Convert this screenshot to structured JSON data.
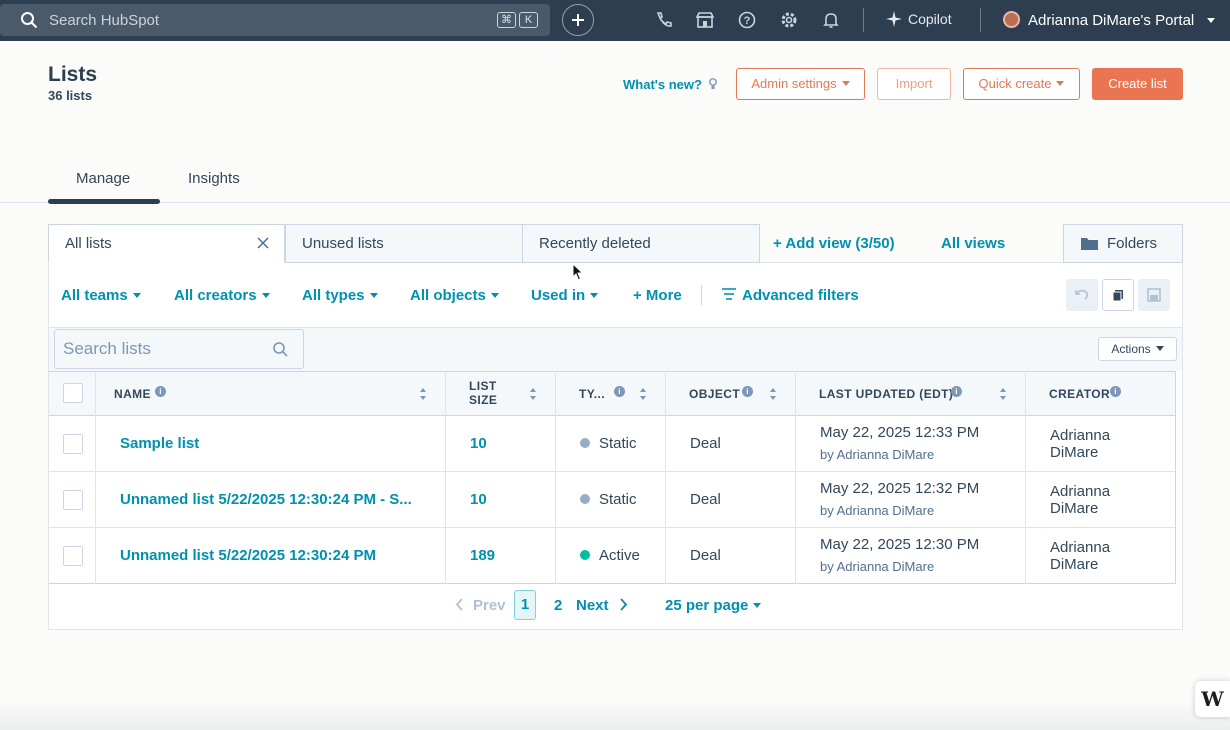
{
  "topnav": {
    "search_placeholder": "Search HubSpot",
    "shortcut_keys": [
      "⌘",
      "K"
    ],
    "copilot_label": "Copilot",
    "portal_label": "Adrianna DiMare's Portal"
  },
  "header": {
    "title": "Lists",
    "count": "36 lists",
    "whats_new": "What's new?",
    "admin_settings": "Admin settings",
    "import": "Import",
    "quick_create": "Quick create",
    "create_list": "Create list"
  },
  "tabs": [
    "Manage",
    "Insights"
  ],
  "views": {
    "tabs": [
      "All lists",
      "Unused lists",
      "Recently deleted"
    ],
    "add_view": "+ Add view (3/50)",
    "all_views": "All views",
    "folders": "Folders"
  },
  "filters": {
    "items": [
      "All teams",
      "All creators",
      "All types",
      "All objects",
      "Used in"
    ],
    "more": "+ More",
    "advanced": "Advanced filters"
  },
  "table": {
    "search_placeholder": "Search lists",
    "actions": "Actions",
    "columns": [
      "NAME",
      "LIST SIZE",
      "TY...",
      "OBJECT",
      "LAST UPDATED (EDT)",
      "CREATOR"
    ],
    "column_list_size_line1": "LIST",
    "column_list_size_line2": "SIZE",
    "rows": [
      {
        "name": "Sample list",
        "size": "10",
        "type": "Static",
        "type_color": "#99acc2",
        "object": "Deal",
        "updated": "May 22, 2025 12:33 PM",
        "by": "by Adrianna DiMare",
        "creator1": "Adrianna",
        "creator2": "DiMare"
      },
      {
        "name": "Unnamed list 5/22/2025 12:30:24 PM - S...",
        "size": "10",
        "type": "Static",
        "type_color": "#99acc2",
        "object": "Deal",
        "updated": "May 22, 2025 12:32 PM",
        "by": "by Adrianna DiMare",
        "creator1": "Adrianna",
        "creator2": "DiMare"
      },
      {
        "name": "Unnamed list 5/22/2025 12:30:24 PM",
        "size": "189",
        "type": "Active",
        "type_color": "#00bda5",
        "object": "Deal",
        "updated": "May 22, 2025 12:30 PM",
        "by": "by Adrianna DiMare",
        "creator1": "Adrianna",
        "creator2": "DiMare"
      }
    ]
  },
  "pagination": {
    "prev": "Prev",
    "current": "1",
    "next_page": "2",
    "next": "Next",
    "per_page": "25 per page"
  },
  "colors": {
    "nav_bg": "#2d3e50",
    "link": "#0091ae",
    "accent": "#ea7552"
  }
}
